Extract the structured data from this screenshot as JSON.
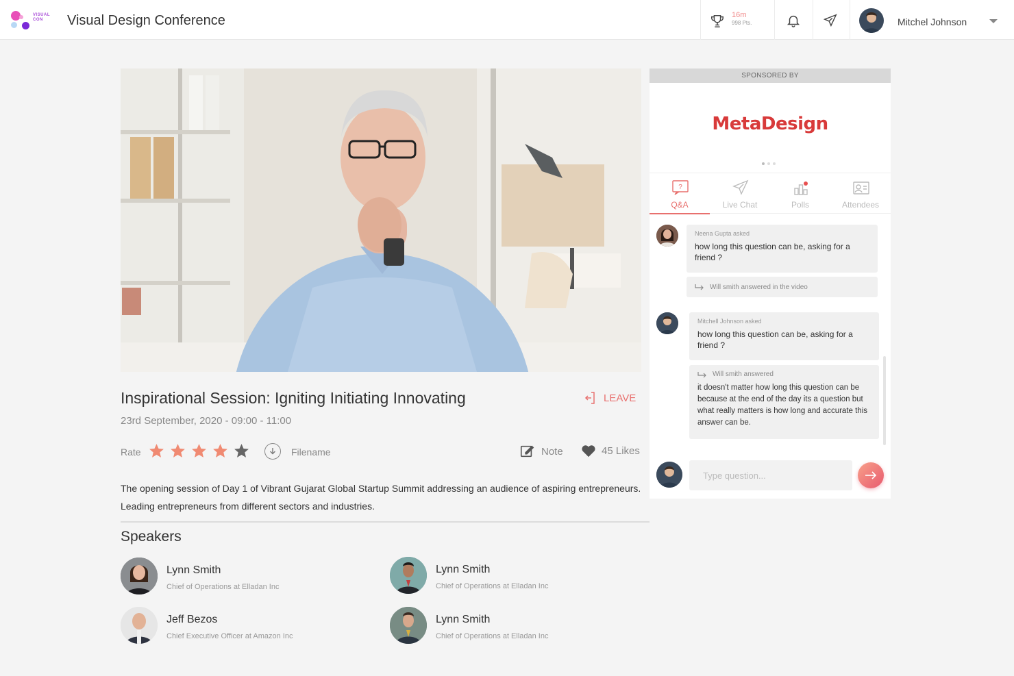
{
  "header": {
    "logo_text": "VISUAL CON",
    "title": "Visual Design Conference",
    "score_time": "16m",
    "score_points": "998 Pts.",
    "user_name": "Mitchel Johnson"
  },
  "session": {
    "title": "Inspirational Session: Igniting Initiating Innovating",
    "date": "23rd September, 2020 - 09:00 - 11:00",
    "leave_label": "LEAVE",
    "rate_label": "Rate",
    "rating": 4,
    "rating_max": 5,
    "filename_label": "Filename",
    "note_label": "Note",
    "likes_label": "45 Likes",
    "description": "The opening session of Day 1 of Vibrant Gujarat Global Startup Summit addressing an audience of aspiring entrepreneurs. Leading entrepreneurs from different sectors and industries."
  },
  "speakers": {
    "heading": "Speakers",
    "items": [
      {
        "name": "Lynn Smith",
        "role": "Chief of Operations at Elladan Inc"
      },
      {
        "name": "Lynn Smith",
        "role": "Chief of Operations at Elladan Inc"
      },
      {
        "name": "Jeff Bezos",
        "role": "Chief Executive Officer at Amazon Inc"
      },
      {
        "name": "Lynn Smith",
        "role": "Chief of Operations at Elladan Inc"
      }
    ]
  },
  "panel": {
    "sponsored_by": "SPONSORED BY",
    "sponsor_name": "MetaDesign",
    "tabs": [
      {
        "label": "Q&A",
        "icon": "qa-icon"
      },
      {
        "label": "Live Chat",
        "icon": "send-icon"
      },
      {
        "label": "Polls",
        "icon": "polls-icon"
      },
      {
        "label": "Attendees",
        "icon": "attendees-icon"
      }
    ],
    "questions": [
      {
        "asker": "Neena Gupta asked",
        "question": "how long this question can be, asking for a friend ?",
        "reply_by": "Will smith answered in the video",
        "reply_text": ""
      },
      {
        "asker": "Mitchell Johnson asked",
        "question": "how long this question can be, asking for a friend ?",
        "reply_by": "Will smith answered",
        "reply_text": "it doesn't matter how long this question can be because at the end of the day its a question but what really matters is how long and accurate this answer can be."
      }
    ],
    "input_placeholder": "Type question..."
  },
  "colors": {
    "accent": "#e8706e",
    "sponsor": "#d83a3a",
    "star_filled": "#f08a72",
    "star_empty": "#666666"
  }
}
